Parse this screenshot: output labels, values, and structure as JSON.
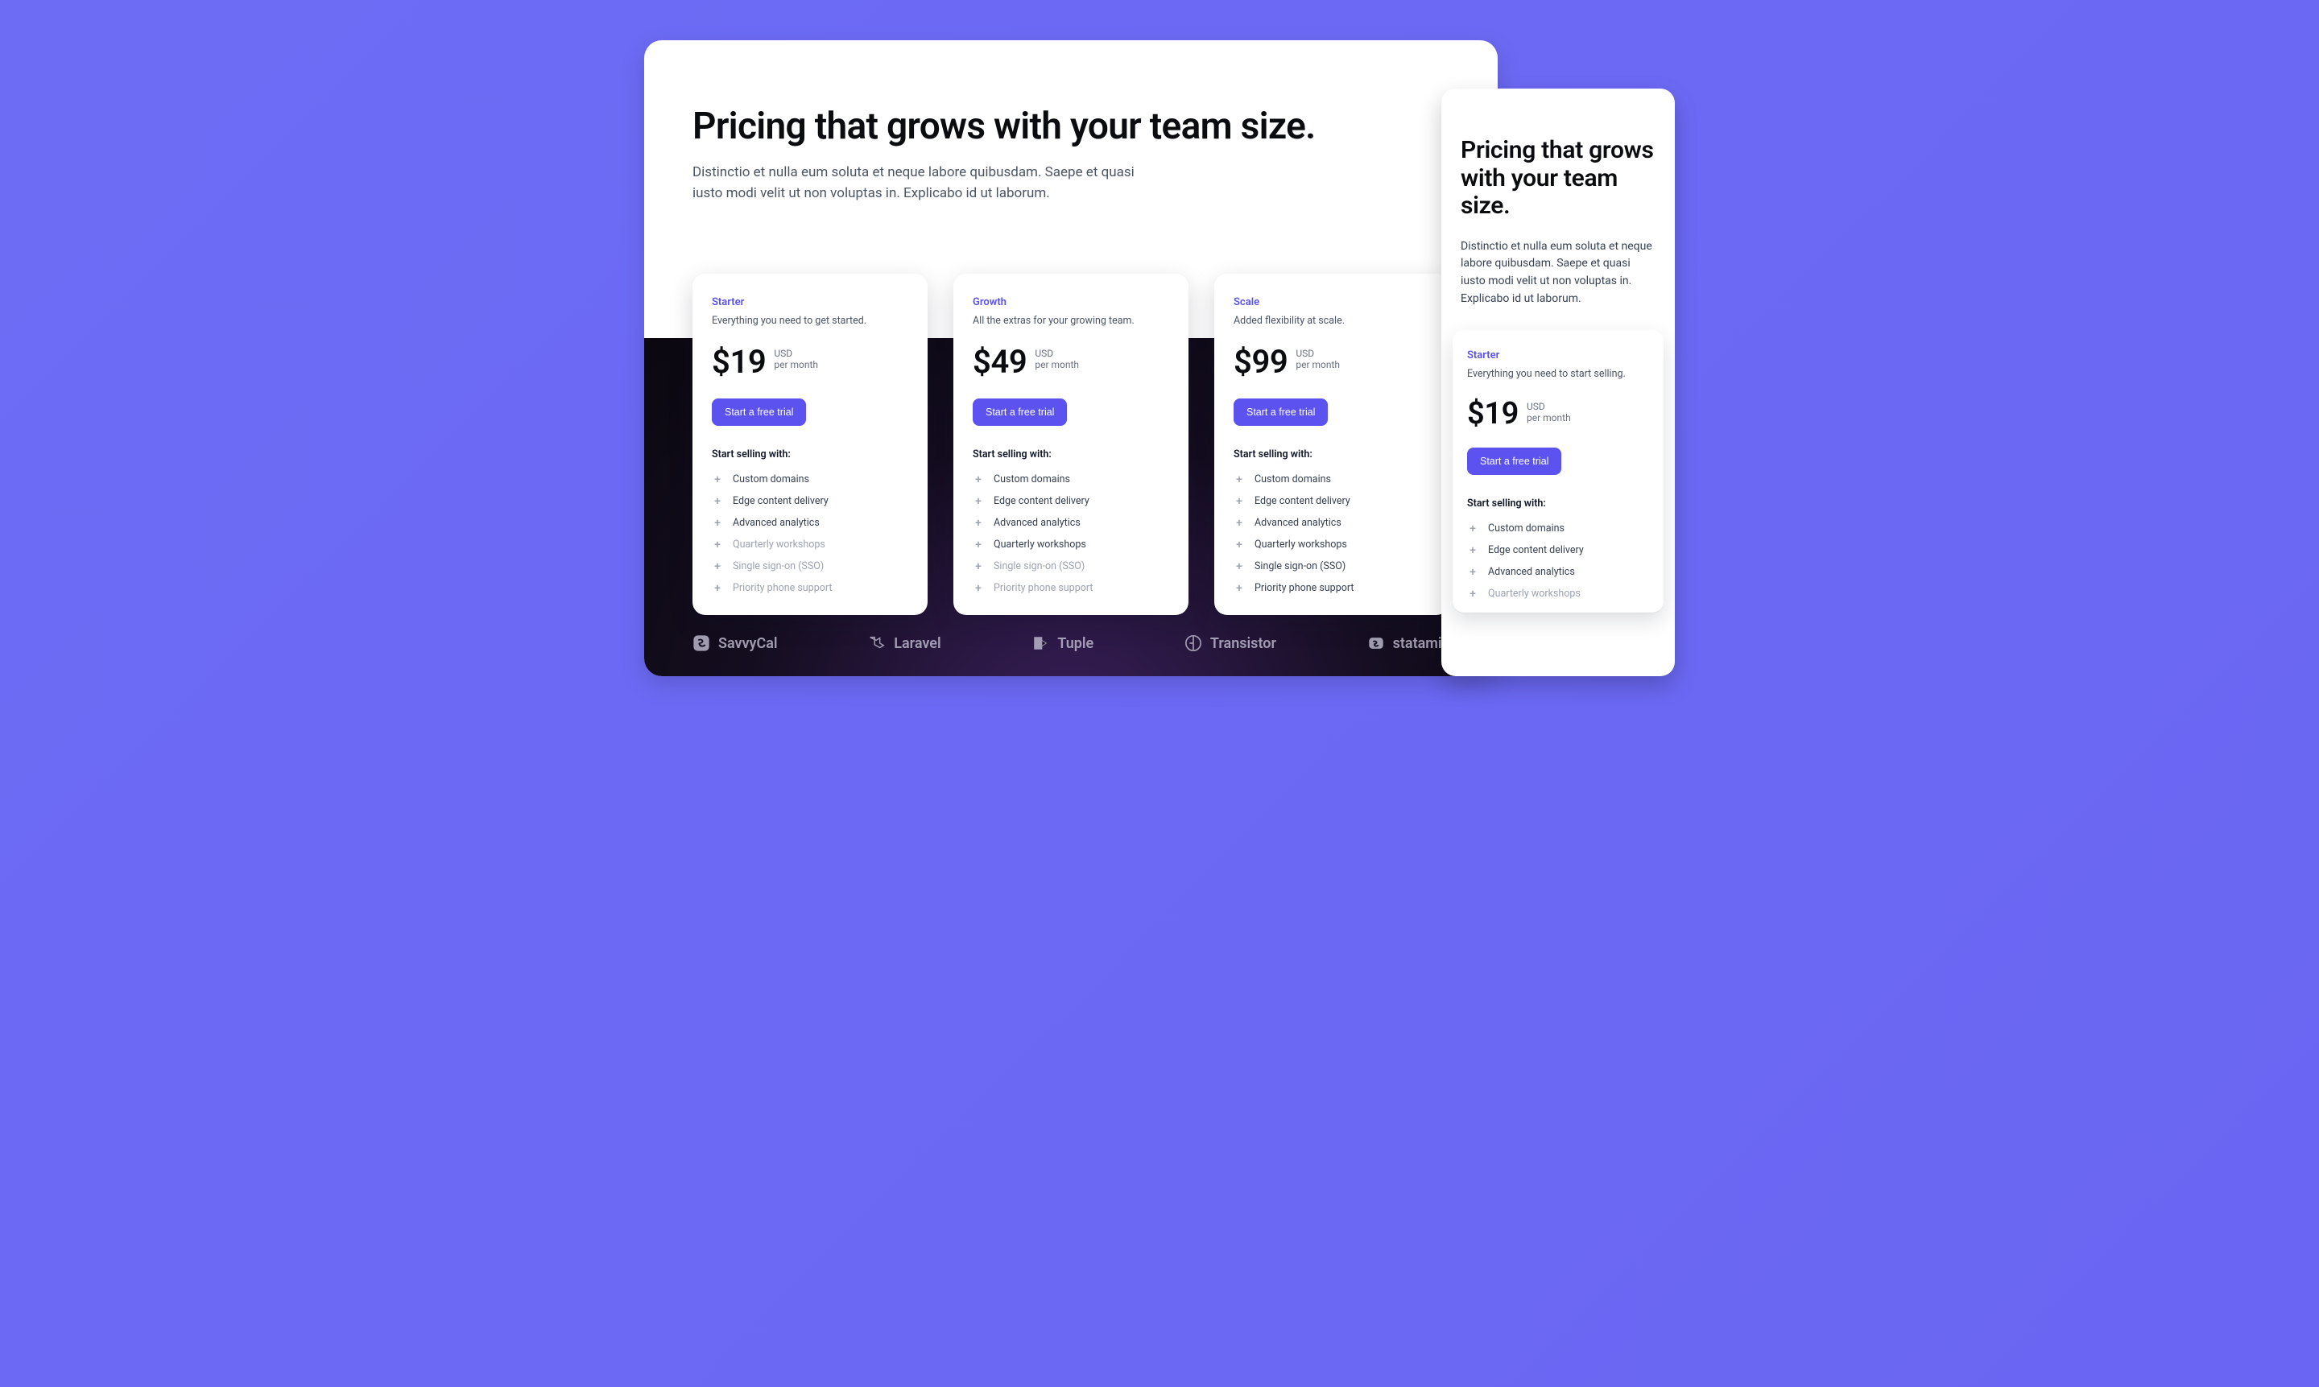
{
  "headline": "Pricing that grows with your team size.",
  "subhead": "Distinctio et nulla eum soluta et neque labore quibusdam. Saepe et quasi iusto modi velit ut non voluptas in. Explicabo id ut laborum.",
  "currency": "USD",
  "period": "per month",
  "cta": "Start a free trial",
  "features_heading": "Start selling with:",
  "features": [
    "Custom domains",
    "Edge content delivery",
    "Advanced analytics",
    "Quarterly workshops",
    "Single sign-on (SSO)",
    "Priority phone support"
  ],
  "plans": [
    {
      "name": "Starter",
      "desc": "Everything you need to get started.",
      "price": "$19",
      "enabled": [
        true,
        true,
        true,
        false,
        false,
        false
      ]
    },
    {
      "name": "Growth",
      "desc": "All the extras for your growing team.",
      "price": "$49",
      "enabled": [
        true,
        true,
        true,
        true,
        false,
        false
      ]
    },
    {
      "name": "Scale",
      "desc": "Added flexibility at scale.",
      "price": "$99",
      "enabled": [
        true,
        true,
        true,
        true,
        true,
        true
      ]
    }
  ],
  "logos": [
    "SavvyCal",
    "Laravel",
    "Tuple",
    "Transistor",
    "statamic"
  ],
  "mobile": {
    "plan": {
      "name": "Starter",
      "desc": "Everything you need to start selling.",
      "price": "$19",
      "enabled": [
        true,
        true,
        true,
        false
      ]
    },
    "features": [
      "Custom domains",
      "Edge content delivery",
      "Advanced analytics",
      "Quarterly workshops"
    ]
  }
}
